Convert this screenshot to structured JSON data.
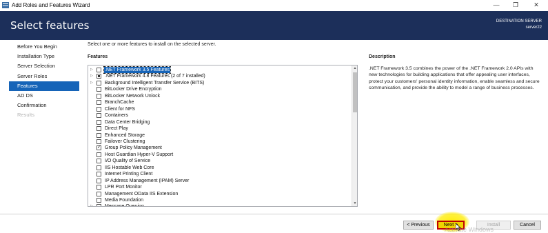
{
  "window": {
    "title": "Add Roles and Features Wizard",
    "minimize_glyph": "—",
    "restore_glyph": "❐",
    "close_glyph": "✕"
  },
  "header": {
    "page_title": "Select features",
    "destination_label": "DESTINATION SERVER",
    "destination_value": "server22"
  },
  "nav": {
    "items": [
      {
        "label": "Before You Begin",
        "state": "normal"
      },
      {
        "label": "Installation Type",
        "state": "normal"
      },
      {
        "label": "Server Selection",
        "state": "normal"
      },
      {
        "label": "Server Roles",
        "state": "normal"
      },
      {
        "label": "Features",
        "state": "active"
      },
      {
        "label": "AD DS",
        "state": "normal"
      },
      {
        "label": "Confirmation",
        "state": "normal"
      },
      {
        "label": "Results",
        "state": "disabled"
      }
    ]
  },
  "main": {
    "intro": "Select one or more features to install on the selected server.",
    "features_header": "Features",
    "features": [
      {
        "label": ".NET Framework 3.5 Features",
        "expandable": true,
        "state": "unchecked",
        "selected": true
      },
      {
        "label": ".NET Framework 4.8 Features (2 of 7 installed)",
        "expandable": true,
        "state": "partial",
        "selected": false
      },
      {
        "label": "Background Intelligent Transfer Service (BITS)",
        "expandable": true,
        "state": "unchecked",
        "selected": false
      },
      {
        "label": "BitLocker Drive Encryption",
        "expandable": false,
        "state": "unchecked",
        "selected": false
      },
      {
        "label": "BitLocker Network Unlock",
        "expandable": false,
        "state": "unchecked",
        "selected": false
      },
      {
        "label": "BranchCache",
        "expandable": false,
        "state": "unchecked",
        "selected": false
      },
      {
        "label": "Client for NFS",
        "expandable": false,
        "state": "unchecked",
        "selected": false
      },
      {
        "label": "Containers",
        "expandable": false,
        "state": "unchecked",
        "selected": false
      },
      {
        "label": "Data Center Bridging",
        "expandable": false,
        "state": "unchecked",
        "selected": false
      },
      {
        "label": "Direct Play",
        "expandable": false,
        "state": "unchecked",
        "selected": false
      },
      {
        "label": "Enhanced Storage",
        "expandable": false,
        "state": "unchecked",
        "selected": false
      },
      {
        "label": "Failover Clustering",
        "expandable": false,
        "state": "unchecked",
        "selected": false
      },
      {
        "label": "Group Policy Management",
        "expandable": false,
        "state": "checked",
        "selected": false
      },
      {
        "label": "Host Guardian Hyper-V Support",
        "expandable": false,
        "state": "unchecked",
        "selected": false
      },
      {
        "label": "I/O Quality of Service",
        "expandable": false,
        "state": "unchecked",
        "selected": false
      },
      {
        "label": "IIS Hostable Web Core",
        "expandable": false,
        "state": "unchecked",
        "selected": false
      },
      {
        "label": "Internet Printing Client",
        "expandable": false,
        "state": "unchecked",
        "selected": false
      },
      {
        "label": "IP Address Management (IPAM) Server",
        "expandable": false,
        "state": "unchecked",
        "selected": false
      },
      {
        "label": "LPR Port Monitor",
        "expandable": false,
        "state": "unchecked",
        "selected": false
      },
      {
        "label": "Management OData IIS Extension",
        "expandable": false,
        "state": "unchecked",
        "selected": false
      },
      {
        "label": "Media Foundation",
        "expandable": false,
        "state": "unchecked",
        "selected": false
      },
      {
        "label": "Message Queuing",
        "expandable": true,
        "state": "unchecked",
        "selected": false
      }
    ],
    "scroll_up_glyph": "▲",
    "scroll_down_glyph": "▼",
    "expand_glyph": "▷"
  },
  "description": {
    "header": "Description",
    "text": ".NET Framework 3.5 combines the power of the .NET Framework 2.0 APIs with new technologies for building applications that offer appealing user interfaces, protect your customers' personal identity information, enable seamless and secure communication, and provide the ability to model a range of business processes."
  },
  "footer": {
    "previous_label": "< Previous",
    "next_label": "Next >",
    "install_label": "Install",
    "cancel_label": "Cancel",
    "watermark": "Activate Windows"
  },
  "colors": {
    "header_bg": "#1c2f5a",
    "nav_active_bg": "#1664b8",
    "highlight_yellow": "#ffec00",
    "next_outline": "#c00000"
  }
}
